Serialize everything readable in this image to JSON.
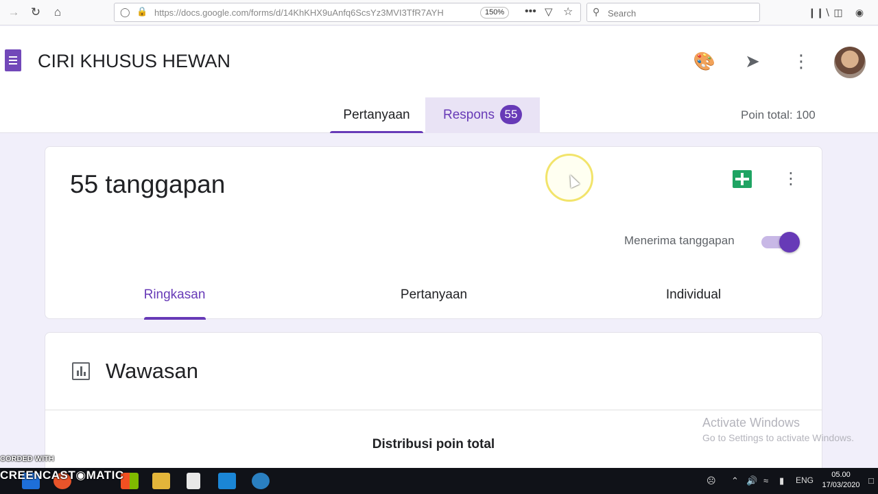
{
  "browser": {
    "url": "https://docs.google.com/forms/d/14KhKHX9uAnfq6ScsYz3MVI3TfR7AYH",
    "zoom": "150%",
    "search_placeholder": "Search"
  },
  "header": {
    "form_title": "CIRI KHUSUS HEWAN",
    "tabs": [
      {
        "label": "Pertanyaan"
      },
      {
        "label": "Respons",
        "badge": "55"
      }
    ],
    "total_points": "Poin total: 100"
  },
  "responses": {
    "title": "55 tanggapan",
    "accept_label": "Menerima tanggapan",
    "accepting": true,
    "subtabs": [
      "Ringkasan",
      "Pertanyaan",
      "Individual"
    ]
  },
  "insights": {
    "title": "Wawasan",
    "distribution_label": "Distribusi poin total"
  },
  "watermark": {
    "activate_title": "Activate Windows",
    "activate_sub": "Go to Settings to activate Windows.",
    "recorded_with": "CORDED WITH",
    "brand": "CREENCAST◉MATIC"
  },
  "taskbar": {
    "language": "ENG",
    "time": "05.00",
    "date": "17/03/2020"
  },
  "colors": {
    "accent": "#673ab7",
    "sheets": "#1fa463",
    "background": "#f1effa"
  }
}
